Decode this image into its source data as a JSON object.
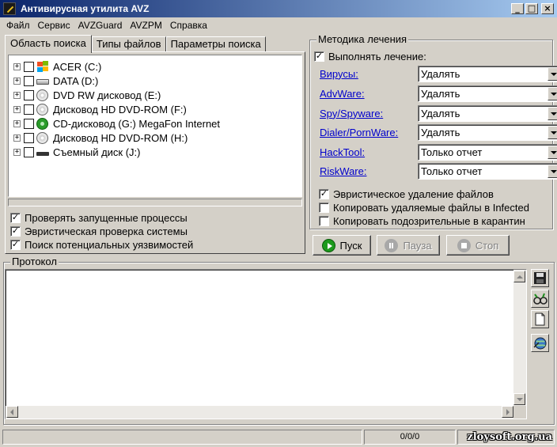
{
  "window": {
    "title": "Антивирусная утилита AVZ",
    "buttons": [
      "_",
      "□",
      "×"
    ]
  },
  "menu": [
    "Файл",
    "Сервис",
    "AVZGuard",
    "AVZPM",
    "Справка"
  ],
  "tabs": [
    {
      "label": "Область поиска",
      "active": true
    },
    {
      "label": "Типы файлов",
      "active": false
    },
    {
      "label": "Параметры поиска",
      "active": false
    }
  ],
  "drives": [
    {
      "label": "ACER (C:)",
      "icon": "windows-drive-icon"
    },
    {
      "label": "DATA (D:)",
      "icon": "hard-drive-icon"
    },
    {
      "label": "DVD RW дисковод (E:)",
      "icon": "cd-drive-icon"
    },
    {
      "label": "Дисковод HD DVD-ROM (F:)",
      "icon": "cd-drive-icon"
    },
    {
      "label": "CD-дисковод (G:) MegaFon Internet",
      "icon": "network-cd-icon"
    },
    {
      "label": "Дисковод HD DVD-ROM (H:)",
      "icon": "cd-drive-icon"
    },
    {
      "label": "Съемный диск (J:)",
      "icon": "removable-drive-icon"
    }
  ],
  "scan_options": [
    {
      "label": "Проверять запущенные процессы",
      "checked": true
    },
    {
      "label": "Эвристическая проверка системы",
      "checked": true
    },
    {
      "label": "Поиск потенциальных уязвимостей",
      "checked": true
    }
  ],
  "treatment": {
    "title": "Методика лечения",
    "perform": {
      "label": "Выполнять лечение:",
      "checked": true
    },
    "rows": [
      {
        "link": "Вирусы:",
        "value": "Удалять"
      },
      {
        "link": "AdvWare:",
        "value": "Удалять"
      },
      {
        "link": "Spy/Spyware:",
        "value": "Удалять"
      },
      {
        "link": "Dialer/PornWare:",
        "value": "Удалять"
      },
      {
        "link": "HackTool:",
        "value": "Только отчет"
      },
      {
        "link": "RiskWare:",
        "value": "Только отчет"
      }
    ],
    "options": [
      {
        "label": "Эвристическое удаление файлов",
        "checked": true
      },
      {
        "label": "Копировать удаляемые файлы в  Infected",
        "checked": false
      },
      {
        "label": "Копировать подозрительные в  карантин",
        "checked": false
      }
    ]
  },
  "actions": {
    "start": "Пуск",
    "pause": "Пауза",
    "stop": "Стоп"
  },
  "log": {
    "title": "Протокол"
  },
  "status": {
    "counter": "0/0/0",
    "watermark": "zloysoft.org.ua"
  }
}
